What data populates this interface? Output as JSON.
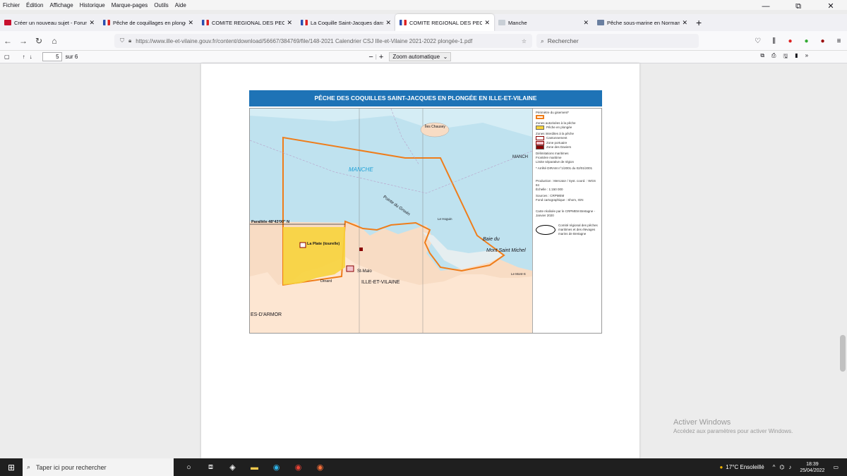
{
  "menu": [
    "Fichier",
    "Édition",
    "Affichage",
    "Historique",
    "Marque-pages",
    "Outils",
    "Aide"
  ],
  "window_controls": {
    "minimize": "—",
    "restore": "⧉",
    "close": "✕"
  },
  "tabs": [
    {
      "label": "Créer un nouveau sujet - Forum",
      "fav_color": "#c8102e",
      "active": false
    },
    {
      "label": "Pêche de coquillages en plongée",
      "fav_color": "#3456b4",
      "active": false
    },
    {
      "label": "COMITE REGIONAL DES PECHES",
      "fav_color": "#3456b4",
      "active": false
    },
    {
      "label": "La Coquille Saint-Jacques dans",
      "fav_color": "#3456b4",
      "active": false
    },
    {
      "label": "COMITE REGIONAL DES PECHES",
      "fav_color": "#3456b4",
      "active": true
    },
    {
      "label": "Manche",
      "fav_color": "#9aa3ad",
      "active": false
    },
    {
      "label": "Pêche sous-marine en Normandie",
      "fav_color": "#6a7fa0",
      "active": false
    }
  ],
  "url": "https://www.ille-et-vilaine.gouv.fr/content/download/56667/384769/file/148-2021 Calendrier CSJ Ille-et-Vilaine 2021-2022 plongée-1.pdf",
  "search_placeholder": "Rechercher",
  "pdf": {
    "page_current": "5",
    "page_total": "sur 6",
    "zoom": "Zoom automatique"
  },
  "map": {
    "title": "PÊCHE DES COQUILLES SAINT-JACQUES EN PLONGÉE EN ILLE-ET-VILAINE",
    "labels": {
      "manche": "MANCHE",
      "chausey": "Îles Chausey",
      "parallel": "Parallèle 48°43'00\" N",
      "plate": "La Plate (tourelle)",
      "stmalo": "St-Malo",
      "dinard": "Dinard",
      "ille": "ILLE-ET-VILAINE",
      "cotes": "ES-D'ARMOR",
      "baie": "Baie du",
      "mont": "Mont Saint Michel",
      "pointe": "Pointe du Grouin",
      "hoguin": "Le Hoguin",
      "montmartin": "Le Mont-S",
      "manche2": "MANCH"
    },
    "legend": {
      "perimetre": "Périmètre du gisement*",
      "zones_auth": "Zones autorisées à la pêche",
      "peche_plongee": "Pêche en plongée",
      "zones_int": "Zones interdites à la pêche",
      "cantonnement": "Cantonnement",
      "zone_portuaire": "Zone portuaire",
      "zone_daviers": "Zone des Daviers",
      "delim": "Délimitations maritimes",
      "frontiere": "Frontière maritime",
      "limite": "Limite séparative de région",
      "arrete": "* Arrêté DIRAM n°1/2001 du 02/01/2001",
      "production": "Production : Mercator / Syst. coord. : WGS 84",
      "echelle": "Échelle : 1:150 000",
      "source": "Sources : CRPMEM",
      "fond": "Fond cartographique : Shom, IGN",
      "carte": "Carte réalisée par le CRPMEM Bretagne - Janvier 2020",
      "comite": "Comité régional des pêches maritimes et des élevages marins de Bretagne"
    }
  },
  "watermark": {
    "line1": "Activer Windows",
    "line2": "Accédez aux paramètres pour activer Windows."
  },
  "taskbar": {
    "search": "Taper ici pour rechercher",
    "weather": "17°C Ensoleillé",
    "time": "18:39",
    "date": "25/04/2022"
  }
}
